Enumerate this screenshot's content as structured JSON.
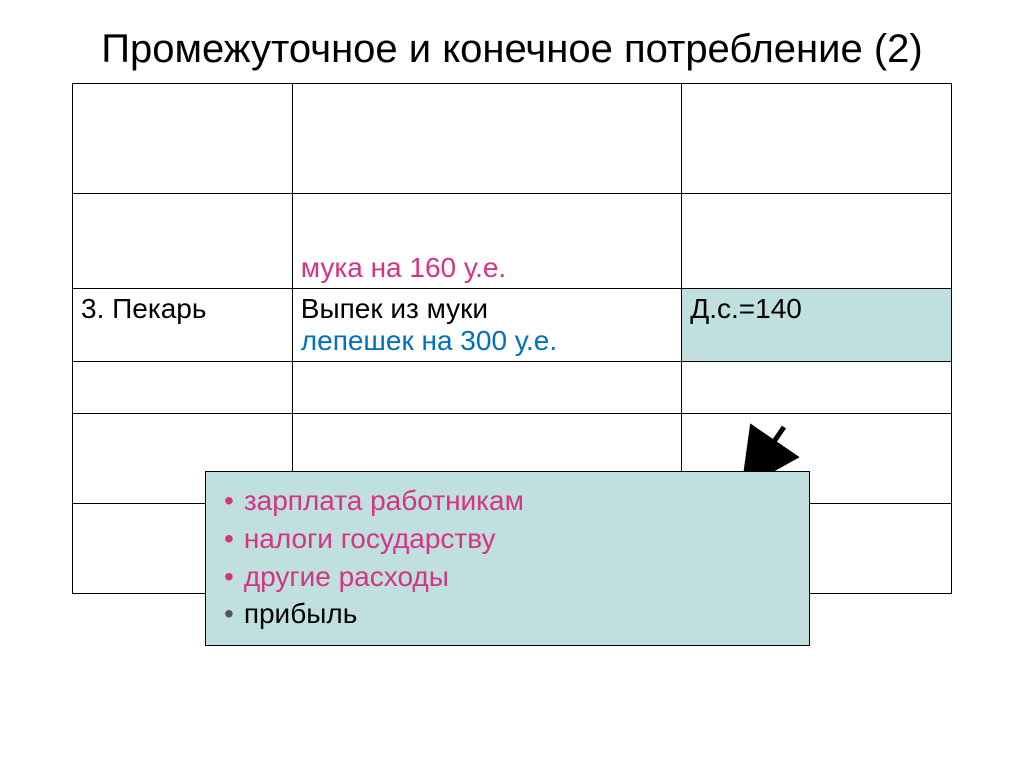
{
  "title": "Промежуточное и конечное потребление (2)",
  "table": {
    "row2_col2": "мука на 160 у.е.",
    "row3_col1": "3. Пекарь",
    "row3_col2_prefix": "Выпек из муки",
    "row3_col2_blue": "лепешек на 300 у.е.",
    "row3_col3": "Д.с.=140"
  },
  "callout": {
    "items": [
      {
        "text": "зарплата работникам",
        "color": "pink"
      },
      {
        "text": "налоги государству",
        "color": "pink"
      },
      {
        "text": "другие расходы",
        "color": "pink"
      },
      {
        "text": "прибыль",
        "color": "black"
      }
    ]
  }
}
